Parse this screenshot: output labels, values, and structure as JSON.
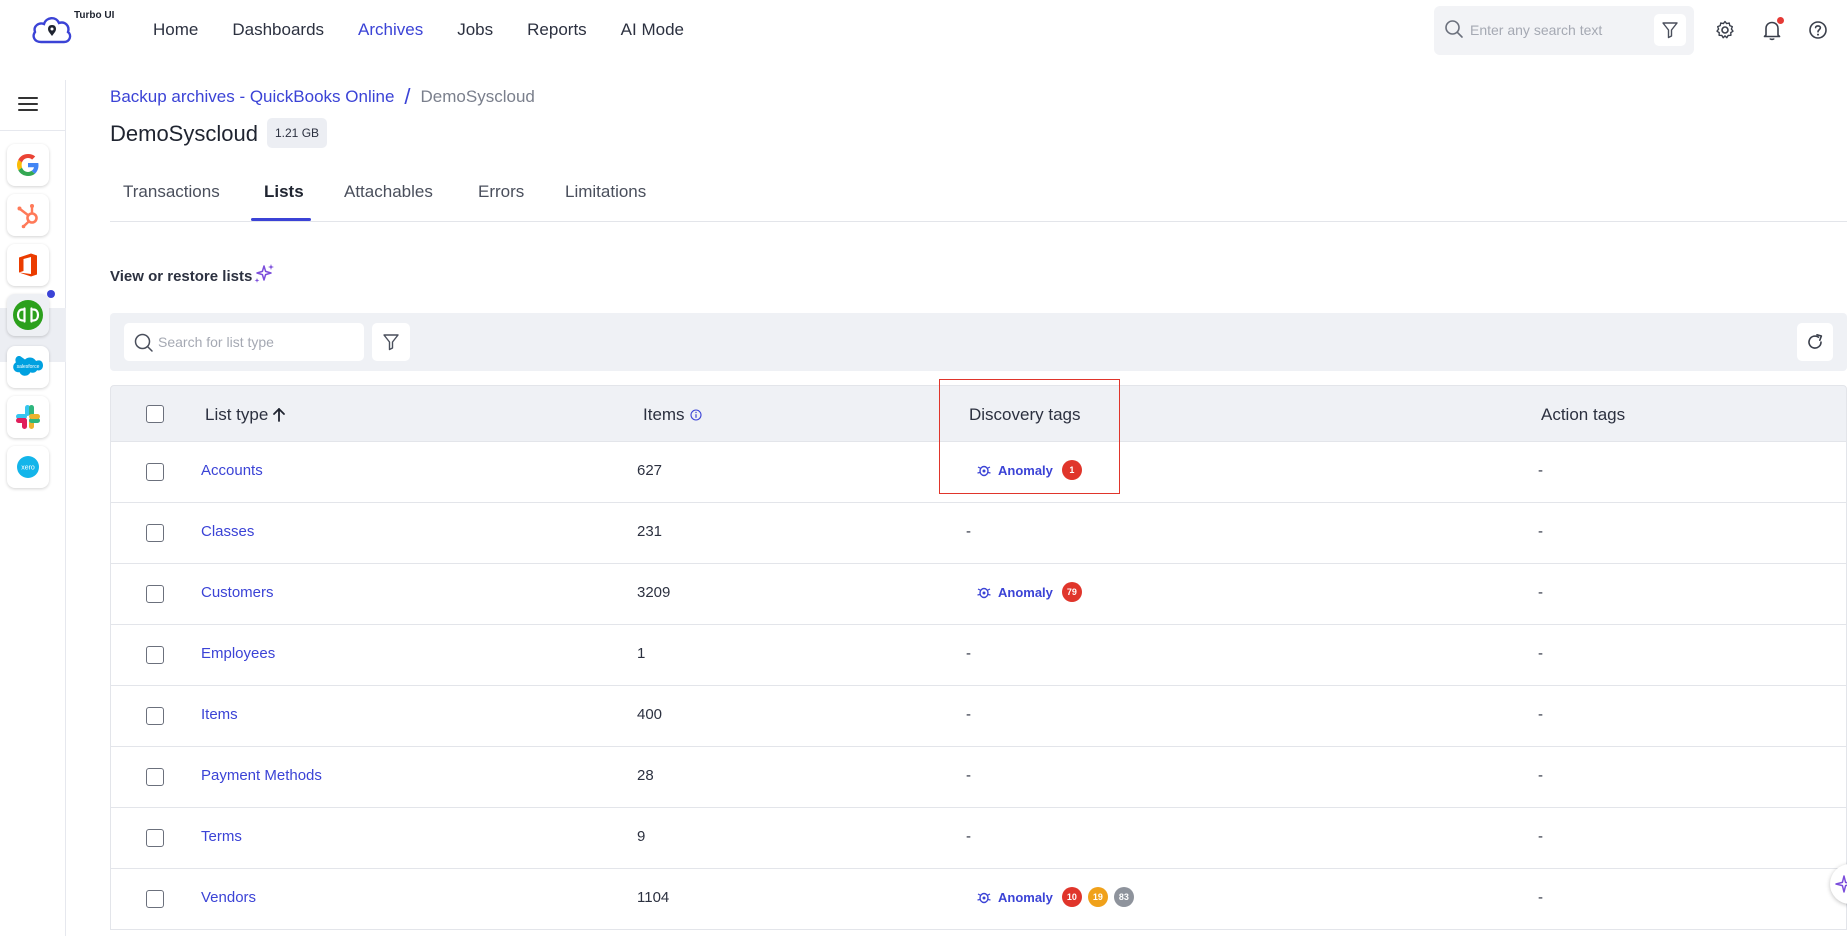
{
  "app": {
    "brand": "Turbo UI"
  },
  "nav": {
    "items": [
      {
        "label": "Home",
        "active": false
      },
      {
        "label": "Dashboards",
        "active": false
      },
      {
        "label": "Archives",
        "active": true
      },
      {
        "label": "Jobs",
        "active": false
      },
      {
        "label": "Reports",
        "active": false
      },
      {
        "label": "AI Mode",
        "active": false
      }
    ]
  },
  "top_search": {
    "placeholder": "Enter any search text"
  },
  "rail": {
    "apps": [
      "google",
      "hubspot",
      "office",
      "quickbooks",
      "salesforce",
      "slack",
      "xero"
    ],
    "active_app": "quickbooks"
  },
  "breadcrumb": {
    "parent": "Backup archives -  QuickBooks Online",
    "separator": "/",
    "current": "DemoSyscloud"
  },
  "page": {
    "title": "DemoSyscloud",
    "size": "1.21 GB"
  },
  "tabs": [
    {
      "label": "Transactions",
      "active": false
    },
    {
      "label": "Lists",
      "active": true
    },
    {
      "label": "Attachables",
      "active": false
    },
    {
      "label": "Errors",
      "active": false
    },
    {
      "label": "Limitations",
      "active": false
    }
  ],
  "section": {
    "label": "View or restore lists"
  },
  "list_search": {
    "placeholder": "Search for list type"
  },
  "table": {
    "columns": {
      "list_type": "List type",
      "items": "Items",
      "discovery": "Discovery tags",
      "action": "Action tags"
    },
    "tag_label": "Anomaly",
    "rows": [
      {
        "name": "Accounts",
        "items": "627",
        "tag": true,
        "counts": [
          "1"
        ],
        "action": "-"
      },
      {
        "name": "Classes",
        "items": "231",
        "tag": false,
        "counts": [],
        "discovery": "-",
        "action": "-"
      },
      {
        "name": "Customers",
        "items": "3209",
        "tag": true,
        "counts": [
          "79"
        ],
        "action": "-"
      },
      {
        "name": "Employees",
        "items": "1",
        "tag": false,
        "counts": [],
        "discovery": "-",
        "action": "-"
      },
      {
        "name": "Items",
        "items": "400",
        "tag": false,
        "counts": [],
        "discovery": "-",
        "action": "-"
      },
      {
        "name": "Payment Methods",
        "items": "28",
        "tag": false,
        "counts": [],
        "discovery": "-",
        "action": "-"
      },
      {
        "name": "Terms",
        "items": "9",
        "tag": false,
        "counts": [],
        "discovery": "-",
        "action": "-"
      },
      {
        "name": "Vendors",
        "items": "1104",
        "tag": true,
        "counts": [
          "10",
          "19",
          "83"
        ],
        "action": "-"
      }
    ]
  },
  "colors": {
    "accent": "#3b43d6",
    "badge_red": "#e0352b",
    "badge_orange": "#f0a11a",
    "badge_gray": "#8e939c",
    "highlight": "#e0352b"
  }
}
